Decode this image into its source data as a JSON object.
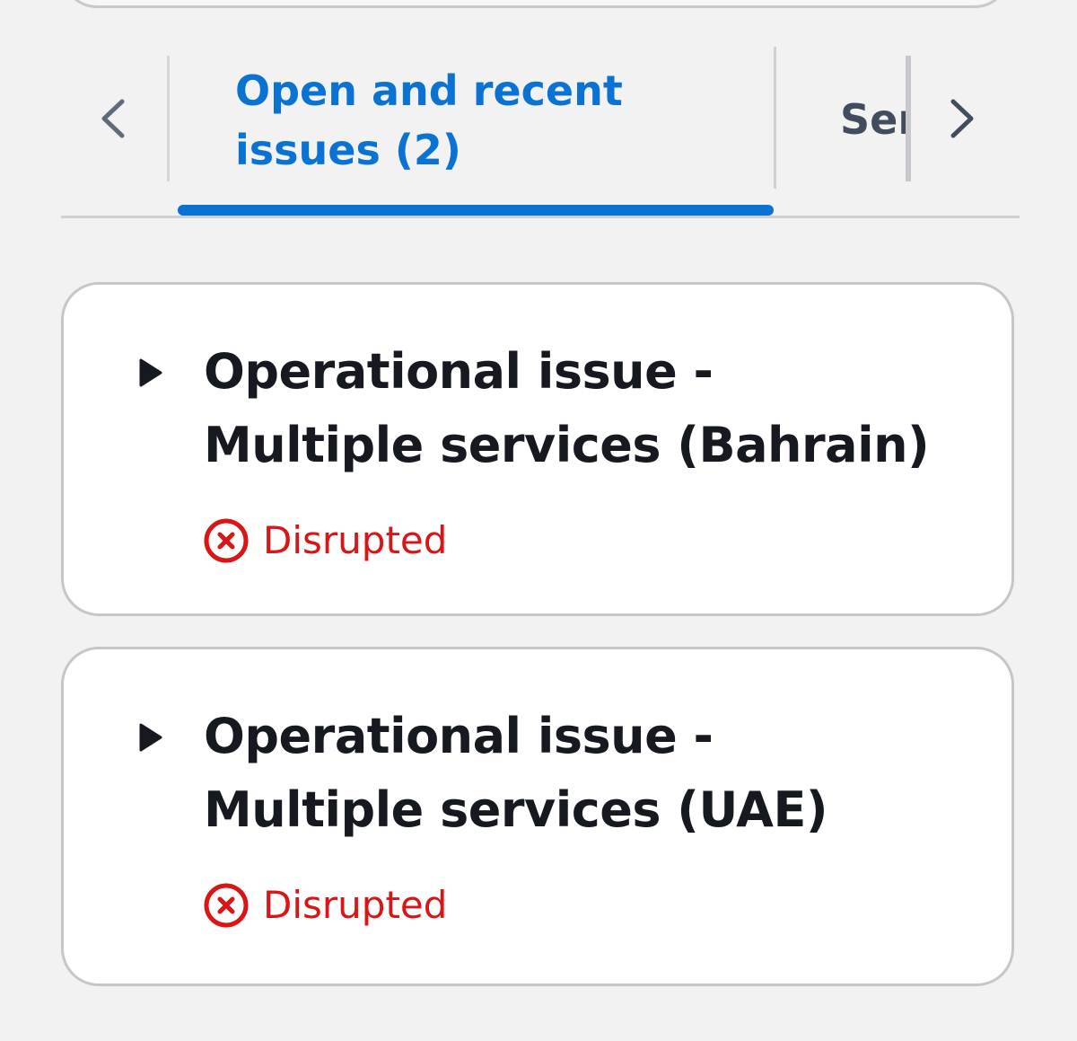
{
  "tabs": {
    "prev_icon": "chevron-left-icon",
    "next_icon": "chevron-right-icon",
    "active_tab": {
      "line1": "Open and recent",
      "line2": "issues (2)"
    },
    "next_tab_label": "Service history",
    "accent_color": "#0972d3"
  },
  "issues": [
    {
      "title_line1": "Operational issue -",
      "title_line2": "Multiple services (Bahrain)",
      "status": "Disrupted",
      "status_icon": "status-error-icon",
      "status_color": "#d91515"
    },
    {
      "title_line1": "Operational issue -",
      "title_line2": "Multiple services (UAE)",
      "status": "Disrupted",
      "status_icon": "status-error-icon",
      "status_color": "#d91515"
    }
  ]
}
